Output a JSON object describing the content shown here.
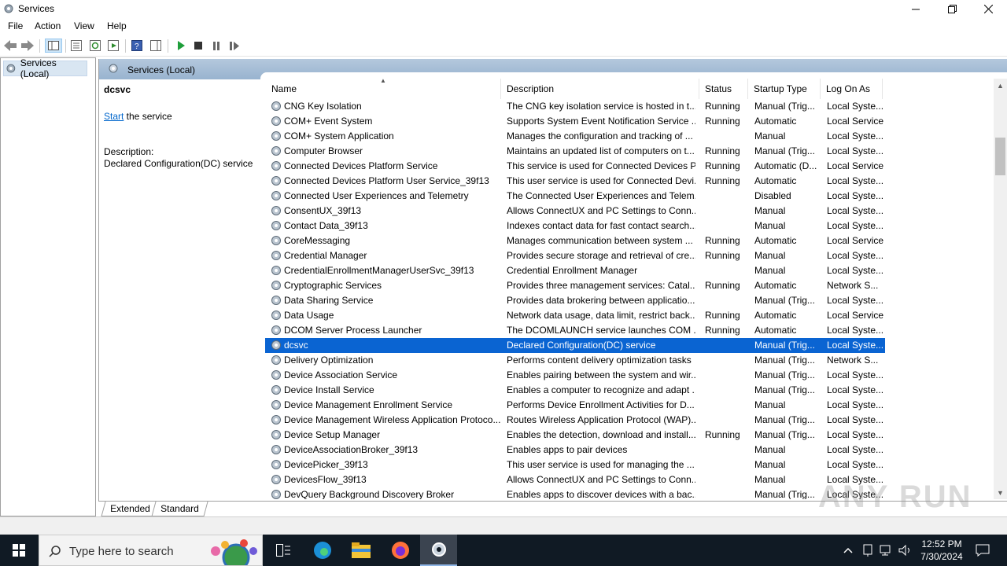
{
  "window": {
    "title": "Services"
  },
  "menu": [
    "File",
    "Action",
    "View",
    "Help"
  ],
  "tree": {
    "root_label": "Services (Local)"
  },
  "main": {
    "header_label": "Services (Local)",
    "selected_service": "dcsvc",
    "start_link": "Start",
    "start_suffix": " the service",
    "description_label": "Description:",
    "description_text": "Declared Configuration(DC) service"
  },
  "columns": {
    "name": "Name",
    "description": "Description",
    "status": "Status",
    "startup": "Startup Type",
    "logon": "Log On As"
  },
  "services": [
    {
      "name": "CNG Key Isolation",
      "description": "The CNG key isolation service is hosted in t...",
      "status": "Running",
      "startup": "Manual (Trig...",
      "logon": "Local Syste..."
    },
    {
      "name": "COM+ Event System",
      "description": "Supports System Event Notification Service ...",
      "status": "Running",
      "startup": "Automatic",
      "logon": "Local Service"
    },
    {
      "name": "COM+ System Application",
      "description": "Manages the configuration and tracking of ...",
      "status": "",
      "startup": "Manual",
      "logon": "Local Syste..."
    },
    {
      "name": "Computer Browser",
      "description": "Maintains an updated list of computers on t...",
      "status": "Running",
      "startup": "Manual (Trig...",
      "logon": "Local Syste..."
    },
    {
      "name": "Connected Devices Platform Service",
      "description": "This service is used for Connected Devices P...",
      "status": "Running",
      "startup": "Automatic (D...",
      "logon": "Local Service"
    },
    {
      "name": "Connected Devices Platform User Service_39f13",
      "description": "This user service is used for Connected Devi...",
      "status": "Running",
      "startup": "Automatic",
      "logon": "Local Syste..."
    },
    {
      "name": "Connected User Experiences and Telemetry",
      "description": "The Connected User Experiences and Telem...",
      "status": "",
      "startup": "Disabled",
      "logon": "Local Syste..."
    },
    {
      "name": "ConsentUX_39f13",
      "description": "Allows ConnectUX and PC Settings to Conn...",
      "status": "",
      "startup": "Manual",
      "logon": "Local Syste..."
    },
    {
      "name": "Contact Data_39f13",
      "description": "Indexes contact data for fast contact search...",
      "status": "",
      "startup": "Manual",
      "logon": "Local Syste..."
    },
    {
      "name": "CoreMessaging",
      "description": "Manages communication between system ...",
      "status": "Running",
      "startup": "Automatic",
      "logon": "Local Service"
    },
    {
      "name": "Credential Manager",
      "description": "Provides secure storage and retrieval of cre...",
      "status": "Running",
      "startup": "Manual",
      "logon": "Local Syste..."
    },
    {
      "name": "CredentialEnrollmentManagerUserSvc_39f13",
      "description": "Credential Enrollment Manager",
      "status": "",
      "startup": "Manual",
      "logon": "Local Syste..."
    },
    {
      "name": "Cryptographic Services",
      "description": "Provides three management services: Catal...",
      "status": "Running",
      "startup": "Automatic",
      "logon": "Network S..."
    },
    {
      "name": "Data Sharing Service",
      "description": "Provides data brokering between applicatio...",
      "status": "",
      "startup": "Manual (Trig...",
      "logon": "Local Syste..."
    },
    {
      "name": "Data Usage",
      "description": "Network data usage, data limit, restrict back...",
      "status": "Running",
      "startup": "Automatic",
      "logon": "Local Service"
    },
    {
      "name": "DCOM Server Process Launcher",
      "description": "The DCOMLAUNCH service launches COM ...",
      "status": "Running",
      "startup": "Automatic",
      "logon": "Local Syste..."
    },
    {
      "name": "dcsvc",
      "description": "Declared Configuration(DC) service",
      "status": "",
      "startup": "Manual (Trig...",
      "logon": "Local Syste...",
      "selected": true
    },
    {
      "name": "Delivery Optimization",
      "description": "Performs content delivery optimization tasks",
      "status": "",
      "startup": "Manual (Trig...",
      "logon": "Network S..."
    },
    {
      "name": "Device Association Service",
      "description": "Enables pairing between the system and wir...",
      "status": "",
      "startup": "Manual (Trig...",
      "logon": "Local Syste..."
    },
    {
      "name": "Device Install Service",
      "description": "Enables a computer to recognize and adapt ...",
      "status": "",
      "startup": "Manual (Trig...",
      "logon": "Local Syste..."
    },
    {
      "name": "Device Management Enrollment Service",
      "description": "Performs Device Enrollment Activities for D...",
      "status": "",
      "startup": "Manual",
      "logon": "Local Syste..."
    },
    {
      "name": "Device Management Wireless Application Protoco...",
      "description": "Routes Wireless Application Protocol (WAP)...",
      "status": "",
      "startup": "Manual (Trig...",
      "logon": "Local Syste..."
    },
    {
      "name": "Device Setup Manager",
      "description": "Enables the detection, download and install...",
      "status": "Running",
      "startup": "Manual (Trig...",
      "logon": "Local Syste..."
    },
    {
      "name": "DeviceAssociationBroker_39f13",
      "description": "Enables apps to pair devices",
      "status": "",
      "startup": "Manual",
      "logon": "Local Syste..."
    },
    {
      "name": "DevicePicker_39f13",
      "description": "This user service is used for managing the ...",
      "status": "",
      "startup": "Manual",
      "logon": "Local Syste..."
    },
    {
      "name": "DevicesFlow_39f13",
      "description": "Allows ConnectUX and PC Settings to Conn...",
      "status": "",
      "startup": "Manual",
      "logon": "Local Syste..."
    },
    {
      "name": "DevQuery Background Discovery Broker",
      "description": "Enables apps to discover devices with a bac...",
      "status": "",
      "startup": "Manual (Trig...",
      "logon": "Local Syste..."
    }
  ],
  "tabs": [
    "Extended",
    "Standard"
  ],
  "taskbar": {
    "search_placeholder": "Type here to search",
    "time": "12:52 PM",
    "date": "7/30/2024"
  },
  "watermark": "ANY RUN",
  "colors": {
    "selection": "#0a64d2",
    "link": "#0066cc",
    "taskbar": "#101a24"
  }
}
